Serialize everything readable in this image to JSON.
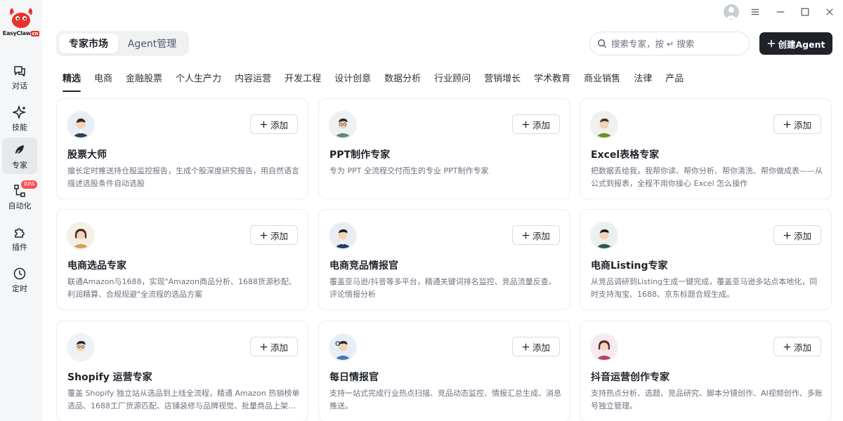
{
  "app": {
    "brand_name": "EasyClaw",
    "brand_suffix": "cn"
  },
  "sidebar": {
    "items": [
      {
        "label": "对话",
        "icon": "chat-icon"
      },
      {
        "label": "技能",
        "icon": "sparkle-icon"
      },
      {
        "label": "专家",
        "icon": "leaf-icon"
      },
      {
        "label": "自动化",
        "icon": "flow-icon",
        "badge": "RPA"
      },
      {
        "label": "插件",
        "icon": "puzzle-icon"
      },
      {
        "label": "定时",
        "icon": "clock-icon"
      }
    ],
    "active_index": 2
  },
  "header": {
    "tabs": [
      "专家市场",
      "Agent管理"
    ],
    "active_tab": 0,
    "search_placeholder": "搜索专家，按 ↵ 搜索",
    "create_label": "创建Agent"
  },
  "categories": {
    "items": [
      "精选",
      "电商",
      "金融股票",
      "个人生产力",
      "内容运营",
      "开发工程",
      "设计创意",
      "数据分析",
      "行业顾问",
      "营销增长",
      "学术教育",
      "商业销售",
      "法律",
      "产品"
    ],
    "active_index": 0
  },
  "cards": [
    {
      "title": "股票大师",
      "desc": "擅长定时推送持仓股监控报告，生成个股深度研究报告，用自然语言描述选股条件自动选股",
      "add_label": "添加"
    },
    {
      "title": "PPT制作专家",
      "desc": "专为 PPT 全流程交付而生的专业 PPT制作专家",
      "add_label": "添加"
    },
    {
      "title": "Excel表格专家",
      "desc": "把数据丢给我，我帮你读、帮你分析、帮你清洗、帮你做成表——从公式到报表，全程不用你操心 Excel 怎么操作",
      "add_label": "添加"
    },
    {
      "title": "电商选品专家",
      "desc": "联通Amazon与1688，实现\"Amazon商品分析、1688货源秒配、利润精算、合规规避\"全流程的选品方案",
      "add_label": "添加"
    },
    {
      "title": "电商竞品情报官",
      "desc": "覆盖亚马逊/抖音等多平台，精通关键词排名监控、竞品流量反查、评论情报分析",
      "add_label": "添加"
    },
    {
      "title": "电商Listing专家",
      "desc": "从竞品调研到Listing生成一键完成，覆盖亚马逊多站点本地化，同时支持淘宝、1688、京东标题合规生成。",
      "add_label": "添加"
    },
    {
      "title": "Shopify 运营专家",
      "desc": "覆盖 Shopify 独立站从选品到上线全流程，精通 Amazon 热销榜单选品、1688工厂货源匹配、店铺装修与品牌视觉、批量商品上架、社媒营销",
      "add_label": "添加"
    },
    {
      "title": "每日情报官",
      "desc": "支持一站式完成行业热点扫描、竞品动态监控、情报汇总生成、消息推送。",
      "add_label": "添加"
    },
    {
      "title": "抖音运营创作专家",
      "desc": "支持热点分析、选题、竞品研究、脚本分镜创作、AI视频创作、多账号独立管理。",
      "add_label": "添加"
    }
  ],
  "colors": {
    "primary": "#1f2329",
    "badge": "#ff4d4f",
    "sidebar_bg": "#f5f6f7",
    "brand_red": "#e8322b"
  }
}
